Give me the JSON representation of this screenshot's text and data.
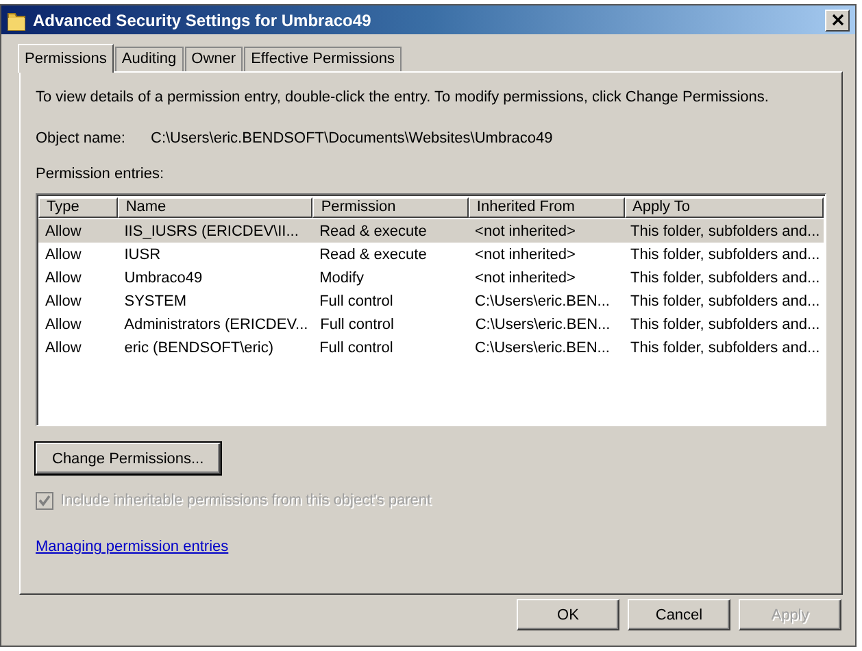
{
  "window": {
    "title": "Advanced Security Settings for Umbraco49"
  },
  "tabs": [
    {
      "label": "Permissions",
      "selected": true
    },
    {
      "label": "Auditing",
      "selected": false
    },
    {
      "label": "Owner",
      "selected": false
    },
    {
      "label": "Effective Permissions",
      "selected": false
    }
  ],
  "instructions": "To view details of a permission entry, double-click the entry. To modify permissions, click Change Permissions.",
  "object_name": {
    "label": "Object name:",
    "value": "C:\\Users\\eric.BENDSOFT\\Documents\\Websites\\Umbraco49"
  },
  "entries_label": "Permission entries:",
  "table": {
    "columns": [
      "Type",
      "Name",
      "Permission",
      "Inherited From",
      "Apply To"
    ],
    "rows": [
      {
        "cells": [
          "Allow",
          "IIS_IUSRS (ERICDEV\\II...",
          "Read & execute",
          "<not inherited>",
          "This folder, subfolders and..."
        ],
        "selected": true
      },
      {
        "cells": [
          "Allow",
          "IUSR",
          "Read & execute",
          "<not inherited>",
          "This folder, subfolders and..."
        ],
        "selected": false
      },
      {
        "cells": [
          "Allow",
          "Umbraco49",
          "Modify",
          "<not inherited>",
          "This folder, subfolders and..."
        ],
        "selected": false
      },
      {
        "cells": [
          "Allow",
          "SYSTEM",
          "Full control",
          "C:\\Users\\eric.BEN...",
          "This folder, subfolders and..."
        ],
        "selected": false
      },
      {
        "cells": [
          "Allow",
          "Administrators (ERICDEV...",
          "Full control",
          "C:\\Users\\eric.BEN...",
          "This folder, subfolders and..."
        ],
        "selected": false
      },
      {
        "cells": [
          "Allow",
          "eric (BENDSOFT\\eric)",
          "Full control",
          "C:\\Users\\eric.BEN...",
          "This folder, subfolders and..."
        ],
        "selected": false
      }
    ]
  },
  "change_button": "Change Permissions...",
  "inherit_checkbox": {
    "label": "Include inheritable permissions from this object's parent",
    "checked": true,
    "disabled": true
  },
  "help_link": "Managing permission entries",
  "buttons": [
    {
      "label": "OK",
      "disabled": false
    },
    {
      "label": "Cancel",
      "disabled": false
    },
    {
      "label": "Apply",
      "disabled": true
    }
  ]
}
